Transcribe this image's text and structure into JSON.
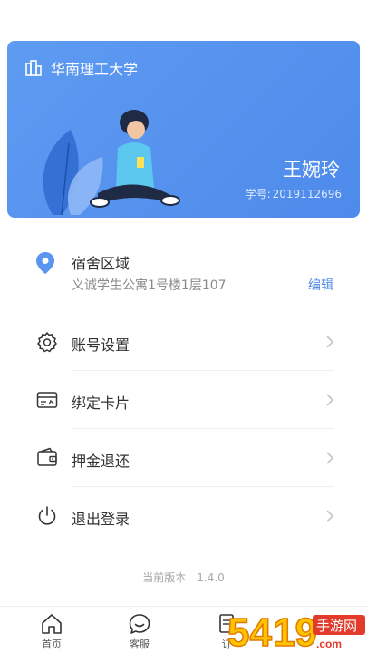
{
  "card": {
    "school_name": "华南理工大学",
    "user_name": "王婉玲",
    "student_id_label": "学号:",
    "student_id": "2019112696"
  },
  "dorm": {
    "title": "宿舍区域",
    "address": "义诚学生公寓1号楼1层107",
    "edit_label": "编辑"
  },
  "menu": [
    {
      "label": "账号设置",
      "icon": "gear-icon"
    },
    {
      "label": "绑定卡片",
      "icon": "card-icon"
    },
    {
      "label": "押金退还",
      "icon": "wallet-icon"
    },
    {
      "label": "退出登录",
      "icon": "power-icon"
    }
  ],
  "version": {
    "label": "当前版本",
    "number": "1.4.0"
  },
  "tabbar": [
    {
      "label": "首页",
      "icon": "home-icon"
    },
    {
      "label": "客服",
      "icon": "chat-icon"
    },
    {
      "label": "订",
      "icon": "order-icon"
    }
  ],
  "watermark": {
    "text": "手游网",
    "sub": "5419 .com"
  },
  "colors": {
    "card_blue": "#5a96f0",
    "accent_blue": "#4f89e8",
    "text_dark": "#333333",
    "text_gray": "#8a8a8a"
  }
}
